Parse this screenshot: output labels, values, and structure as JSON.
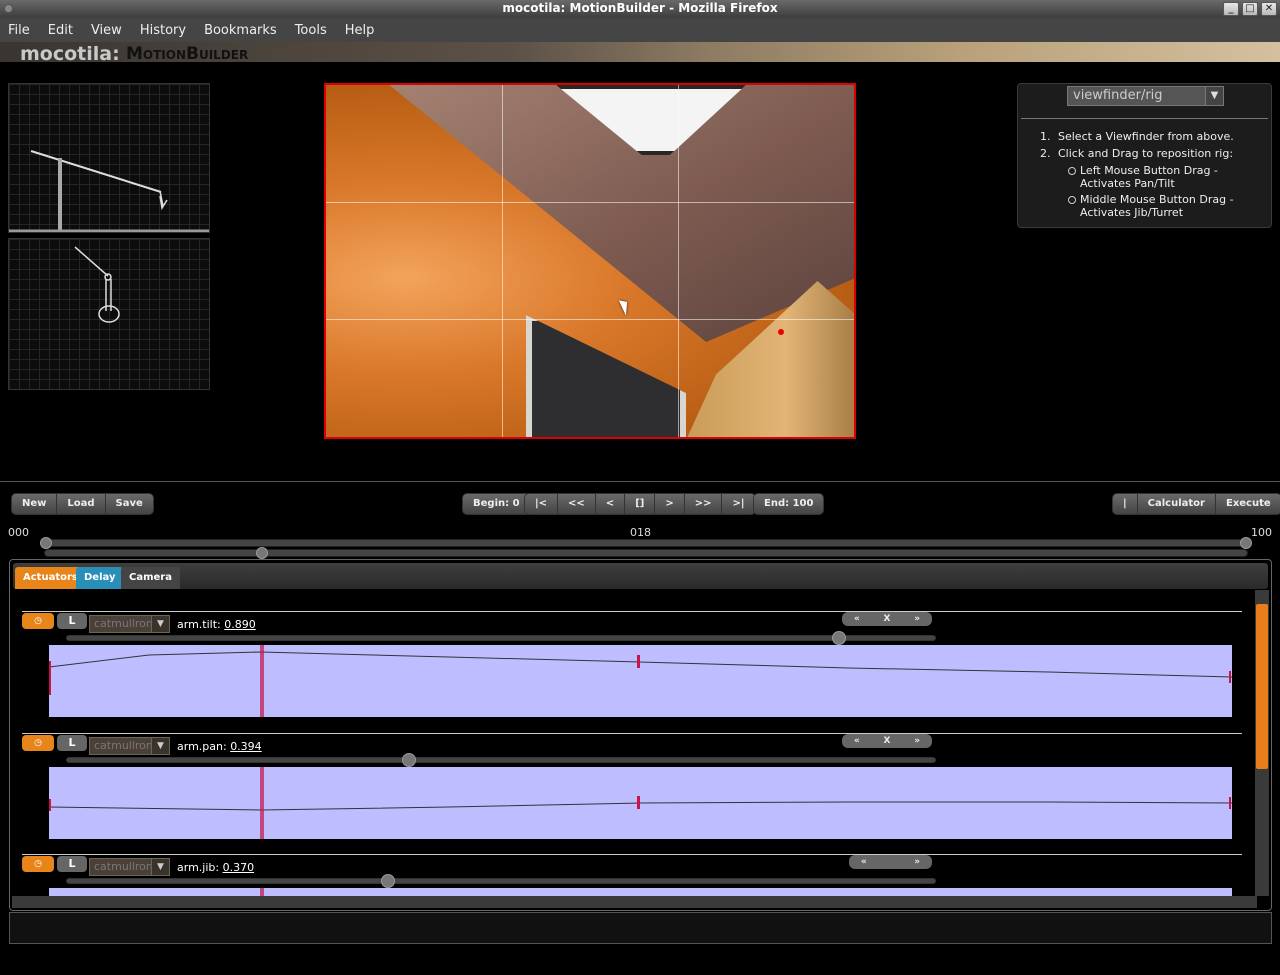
{
  "window": {
    "title": "mocotila: MotionBuilder - Mozilla Firefox",
    "buttons": [
      "_",
      "□",
      "✕"
    ]
  },
  "menu": [
    "File",
    "Edit",
    "View",
    "History",
    "Bookmarks",
    "Tools",
    "Help"
  ],
  "banner": {
    "brand": "mocotila:",
    "product": "MotionBuilder"
  },
  "info": {
    "select_value": "viewfinder/rig",
    "step1": "Select a Viewfinder from above.",
    "step2": "Click and Drag to reposition rig:",
    "sub1": "Left Mouse Button Drag - Activates Pan/Tilt",
    "sub2": "Middle Mouse Button Drag - Activates Jib/Turret",
    "n1": "1.",
    "n2": "2."
  },
  "toolbar": {
    "new": "New",
    "load": "Load",
    "save": "Save",
    "begin": "Begin: 0",
    "first": "|<",
    "rewind": "<<",
    "prev": "<",
    "stop": "[]",
    "next": ">",
    "ffwd": ">>",
    "last": ">|",
    "end": "End: 100",
    "sep": "|",
    "calculator": "Calculator",
    "execute": "Execute"
  },
  "timeline": {
    "start": "000",
    "current": "018",
    "end": "100",
    "position": 0.18
  },
  "tabs": {
    "actuators": "Actuators",
    "delay": "Delay",
    "camera": "Camera"
  },
  "rows": [
    {
      "clock": "◷",
      "lock": "L",
      "interp": "catmullrom",
      "name": "arm.tilt:",
      "value": "0.890",
      "prev": "«",
      "del": "X",
      "next": "»"
    },
    {
      "clock": "◷",
      "lock": "L",
      "interp": "catmullrom",
      "name": "arm.pan:",
      "value": "0.394",
      "prev": "«",
      "del": "X",
      "next": "»"
    },
    {
      "clock": "◷",
      "lock": "L",
      "interp": "catmullrom",
      "name": "arm.jib:",
      "value": "0.370",
      "prev": "«",
      "del": "",
      "next": "»"
    }
  ],
  "colors": {
    "accent": "#e8851a",
    "delay_tab": "#2a8fb8",
    "curve_bg": "#bdbdff",
    "keyframe": "#c8144a",
    "viewfinder_border": "#dd0000"
  }
}
